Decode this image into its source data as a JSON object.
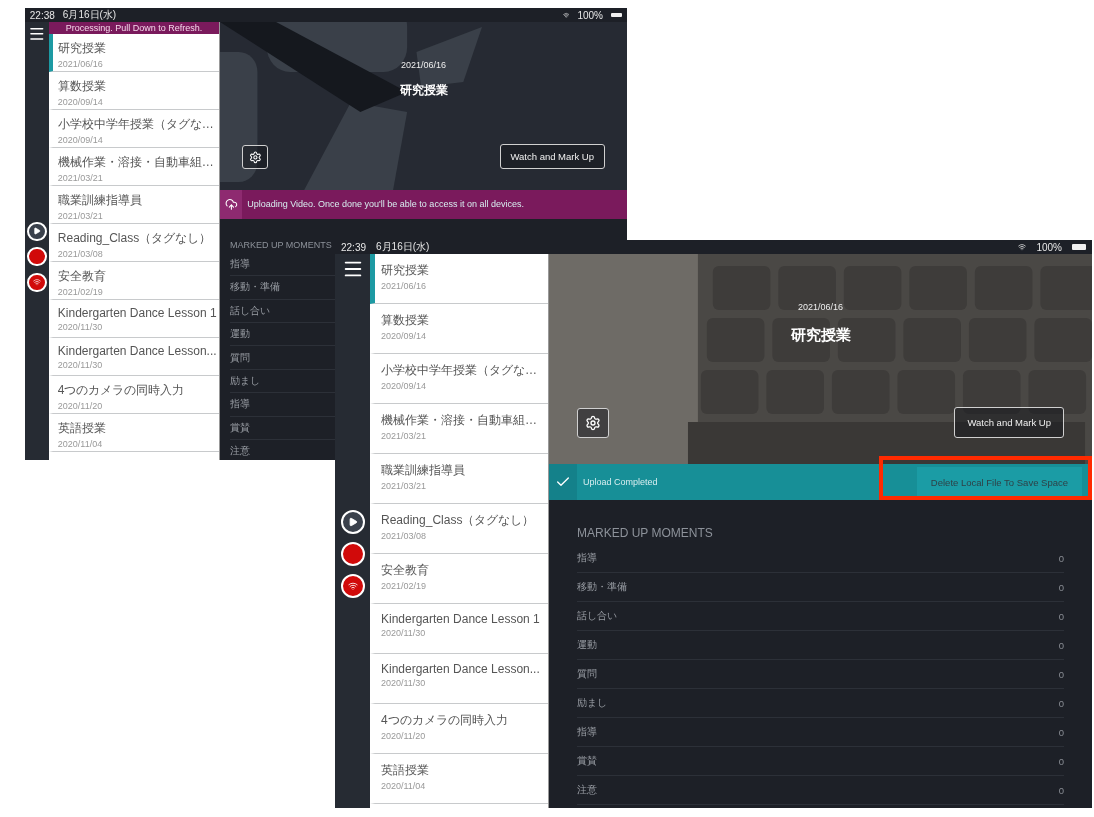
{
  "screens": [
    {
      "status": {
        "time": "22:38",
        "date": "6月16日(水)",
        "battery": "100%"
      },
      "notice": "Processing. Pull Down to Refresh.",
      "sessions": [
        {
          "title": "研究授業",
          "date": "2021/06/16",
          "selected": true
        },
        {
          "title": "算数授業",
          "date": "2020/09/14",
          "selected": false
        },
        {
          "title": "小学校中学年授業（タグな…",
          "date": "2020/09/14",
          "selected": false
        },
        {
          "title": "機械作業・溶接・自動車組…",
          "date": "2021/03/21",
          "selected": false
        },
        {
          "title": "職業訓練指導員",
          "date": "2021/03/21",
          "selected": false
        },
        {
          "title": "Reading_Class（タグなし）",
          "date": "2021/03/08",
          "selected": false
        },
        {
          "title": "安全教育",
          "date": "2021/02/19",
          "selected": false
        },
        {
          "title": "Kindergarten Dance Lesson 1",
          "date": "2020/11/30",
          "selected": false
        },
        {
          "title": "Kindergarten Dance Lesson...",
          "date": "2020/11/30",
          "selected": false
        },
        {
          "title": "4つのカメラの同時入力",
          "date": "2020/11/20",
          "selected": false
        },
        {
          "title": "英語授業",
          "date": "2020/11/04",
          "selected": false
        }
      ],
      "header": {
        "date": "2021/06/16",
        "title": "研究授業",
        "action": "Watch and Mark Up"
      },
      "banner": {
        "kind": "uploading",
        "message": "Uploading Video. Once done you'll be able to access it on all devices."
      },
      "moments_title": "MARKED UP MOMENTS",
      "moments": [
        {
          "label": "指導"
        },
        {
          "label": "移動・準備"
        },
        {
          "label": "話し合い"
        },
        {
          "label": "運動"
        },
        {
          "label": "質問"
        },
        {
          "label": "励まし"
        },
        {
          "label": "指導"
        },
        {
          "label": "賞賛"
        },
        {
          "label": "注意"
        }
      ]
    },
    {
      "status": {
        "time": "22:39",
        "date": "6月16日(水)",
        "battery": "100%"
      },
      "sessions": [
        {
          "title": "研究授業",
          "date": "2021/06/16",
          "selected": true
        },
        {
          "title": "算数授業",
          "date": "2020/09/14",
          "selected": false
        },
        {
          "title": "小学校中学年授業（タグな…",
          "date": "2020/09/14",
          "selected": false
        },
        {
          "title": "機械作業・溶接・自動車組…",
          "date": "2021/03/21",
          "selected": false
        },
        {
          "title": "職業訓練指導員",
          "date": "2021/03/21",
          "selected": false
        },
        {
          "title": "Reading_Class（タグなし）",
          "date": "2021/03/08",
          "selected": false
        },
        {
          "title": "安全教育",
          "date": "2021/02/19",
          "selected": false
        },
        {
          "title": "Kindergarten Dance Lesson 1",
          "date": "2020/11/30",
          "selected": false
        },
        {
          "title": "Kindergarten Dance Lesson...",
          "date": "2020/11/30",
          "selected": false
        },
        {
          "title": "4つのカメラの同時入力",
          "date": "2020/11/20",
          "selected": false
        },
        {
          "title": "英語授業",
          "date": "2020/11/04",
          "selected": false
        }
      ],
      "header": {
        "date": "2021/06/16",
        "title": "研究授業",
        "action": "Watch and Mark Up"
      },
      "banner": {
        "kind": "completed",
        "message": "Upload Completed",
        "button": "Delete Local File To Save Space",
        "highlighted": true
      },
      "moments_title": "MARKED UP MOMENTS",
      "moments": [
        {
          "label": "指導",
          "count": "0"
        },
        {
          "label": "移動・準備",
          "count": "0"
        },
        {
          "label": "話し合い",
          "count": "0"
        },
        {
          "label": "運動",
          "count": "0"
        },
        {
          "label": "質問",
          "count": "0"
        },
        {
          "label": "励まし",
          "count": "0"
        },
        {
          "label": "指導",
          "count": "0"
        },
        {
          "label": "賞賛",
          "count": "0"
        },
        {
          "label": "注意",
          "count": "0"
        }
      ]
    }
  ]
}
